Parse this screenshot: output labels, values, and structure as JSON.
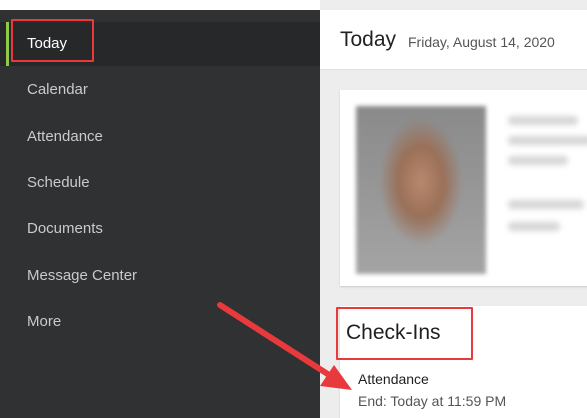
{
  "sidebar": {
    "items": [
      {
        "label": "Today",
        "active": true
      },
      {
        "label": "Calendar"
      },
      {
        "label": "Attendance"
      },
      {
        "label": "Schedule"
      },
      {
        "label": "Documents"
      },
      {
        "label": "Message Center"
      },
      {
        "label": "More"
      }
    ]
  },
  "header": {
    "title": "Today",
    "date": "Friday, August 14, 2020"
  },
  "checkins": {
    "title": "Check-Ins",
    "items": [
      {
        "name": "Attendance",
        "end": "End: Today at 11:59 PM"
      }
    ]
  },
  "colors": {
    "sidebar_bg": "#2f3132",
    "active_accent": "#8fc94a",
    "annotation_red": "#e8393d"
  },
  "icons": [
    "annotation-arrow-icon"
  ]
}
